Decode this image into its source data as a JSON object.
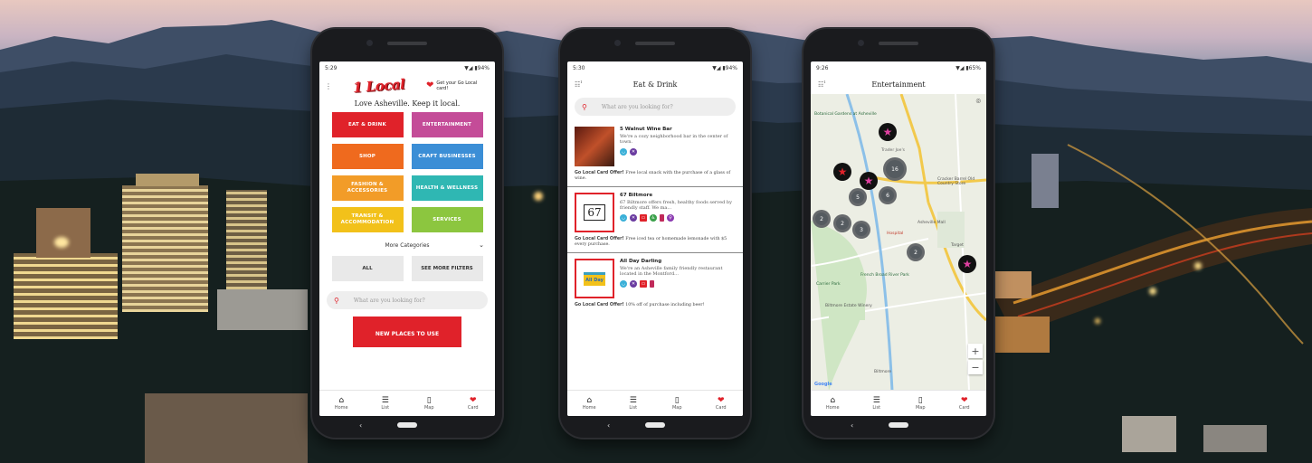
{
  "colors": {
    "brand_red": "#e0222a",
    "eat_drink": "#e0222a",
    "entertainment": "#c44c98",
    "shop": "#ef6a1e",
    "craft": "#3b8ed6",
    "fashion": "#f29c28",
    "health": "#2fb7b3",
    "transit": "#f2c11a",
    "services": "#8cc63f"
  },
  "phone1": {
    "status_time": "5:29",
    "status_right": "▼◢ ▮94%",
    "logo": "1 Local",
    "card_hint": "Get your Go Local card!",
    "tagline": "Love Asheville. Keep it local.",
    "categories": [
      {
        "label": "EAT & DRINK",
        "color": "#e0222a"
      },
      {
        "label": "ENTERTAINMENT",
        "color": "#c44c98"
      },
      {
        "label": "SHOP",
        "color": "#ef6a1e"
      },
      {
        "label": "CRAFT BUSINESSES",
        "color": "#3b8ed6"
      },
      {
        "label": "FASHION & ACCESSORIES",
        "color": "#f29c28"
      },
      {
        "label": "HEALTH & WELLNESS",
        "color": "#2fb7b3"
      },
      {
        "label": "TRANSIT & ACCOMMODATION",
        "color": "#f2c11a"
      },
      {
        "label": "SERVICES",
        "color": "#8cc63f"
      }
    ],
    "more_categories": "More Categories",
    "all_label": "ALL",
    "filters_label": "SEE MORE FILTERS",
    "search_placeholder": "What are you looking for?",
    "promo": "NEW PLACES TO USE"
  },
  "phone2": {
    "status_time": "5:30",
    "status_right": "▼◢ ▮94%",
    "title": "Eat & Drink",
    "filter_count": "1",
    "search_placeholder": "What are you looking for?",
    "listings": [
      {
        "name": "5 Walnut Wine Bar",
        "desc": "We're a cozy neighborhood bar in the center of town.",
        "offer_label": "Go Local Card Offer!",
        "offer": "Free local snack with the purchase of a glass of wine.",
        "thumb": "#7a2a1e"
      },
      {
        "name": "67 Biltmore",
        "desc": "67 Biltmore offers fresh, healthy foods served by friendly staff. We ma...",
        "offer_label": "Go Local Card Offer!",
        "offer": "Free iced tea or homemade lemonade with $5 every purchase.",
        "thumb": "#ffffff"
      },
      {
        "name": "All Day Darling",
        "desc": "We're an Asheville family friendly restaurant located in the Montford...",
        "offer_label": "Go Local Card Offer!",
        "offer": "10% off of purchase including beer!",
        "thumb": "#ffffff"
      }
    ]
  },
  "phone3": {
    "status_time": "9:26",
    "status_right": "▼◢ ▮65%",
    "title": "Entertainment",
    "filter_count": "1",
    "clusters": [
      "16",
      "5",
      "6",
      "2",
      "2",
      "3",
      "2"
    ],
    "map_labels": [
      "Botanical Gardens at Asheville",
      "Trader Joe's",
      "Cracker Barrel Old Country Store",
      "Asheville Mall",
      "Target",
      "French Broad River Park",
      "Carrier Park",
      "Biltmore Estate Winery",
      "Biltmore",
      "Hospital",
      "Google"
    ],
    "zoom_in": "+",
    "zoom_out": "−"
  },
  "nav": {
    "home": "Home",
    "list": "List",
    "map": "Map",
    "card": "Card"
  }
}
